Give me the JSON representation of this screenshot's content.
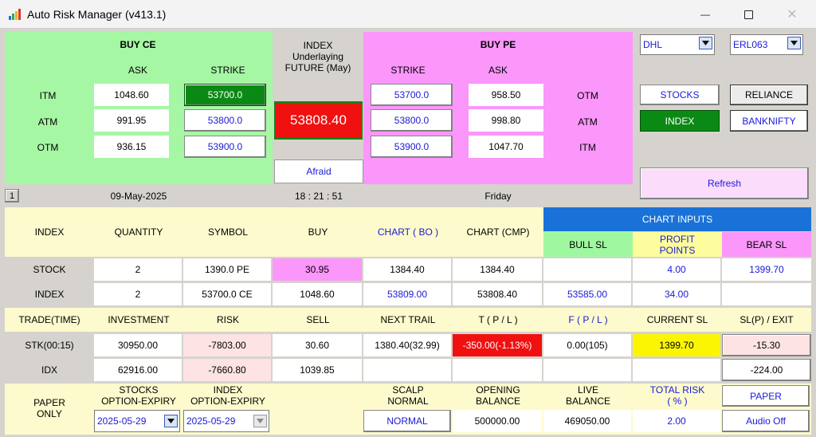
{
  "window": {
    "title": "Auto Risk Manager (v413.1)",
    "minimize_glyph": "—",
    "maximize_glyph": "☐",
    "close_glyph": "✕"
  },
  "buy_ce": {
    "title": "BUY CE",
    "col_ask": "ASK",
    "col_strike": "STRIKE",
    "rows": [
      {
        "label": "ITM",
        "ask": "1048.60",
        "strike": "53700.0"
      },
      {
        "label": "ATM",
        "ask": "991.95",
        "strike": "53800.0"
      },
      {
        "label": "OTM",
        "ask": "936.15",
        "strike": "53900.0"
      }
    ]
  },
  "index_center": {
    "line1": "INDEX",
    "line2": "Underlaying",
    "line3": "FUTURE (May)",
    "price": "53808.40",
    "mood_button": "Afraid"
  },
  "buy_pe": {
    "title": "BUY PE",
    "col_strike": "STRIKE",
    "col_ask": "ASK",
    "rows": [
      {
        "label": "OTM",
        "strike": "53700.0",
        "ask": "958.50"
      },
      {
        "label": "ATM",
        "strike": "53800.0",
        "ask": "998.80"
      },
      {
        "label": "ITM",
        "strike": "53900.0",
        "ask": "1047.70"
      }
    ]
  },
  "right_panel": {
    "dropdown1": "DHL",
    "dropdown2": "ERL063",
    "stocks_btn": "STOCKS",
    "reliance_btn": "RELIANCE",
    "index_btn": "INDEX",
    "banknifty_btn": "BANKNIFTY",
    "refresh_btn": "Refresh"
  },
  "status_bar": {
    "small_button": "1",
    "date": "09-May-2025",
    "time": "18 : 21 : 51",
    "day": "Friday"
  },
  "grid": {
    "headers": {
      "index": "INDEX",
      "quantity": "QUANTITY",
      "symbol": "SYMBOL",
      "buy": "BUY",
      "chart_bo": "CHART ( BO )",
      "chart_cmp": "CHART (CMP)",
      "chart_inputs": "CHART INPUTS",
      "bull_sl": "BULL SL",
      "profit_points": "PROFIT\nPOINTS",
      "bear_sl": "BEAR SL"
    },
    "rows": [
      {
        "label": "STOCK",
        "quantity": "2",
        "symbol": "1390.0  PE",
        "buy": "30.95",
        "chart_bo": "1384.40",
        "chart_cmp": "1384.40",
        "bull_sl": "",
        "profit_points": "4.00",
        "bear_sl": "1399.70"
      },
      {
        "label": "INDEX",
        "quantity": "2",
        "symbol": "53700.0  CE",
        "buy": "1048.60",
        "chart_bo": "53809.00",
        "chart_cmp": "53808.40",
        "bull_sl": "53585.00",
        "profit_points": "34.00",
        "bear_sl": ""
      }
    ],
    "headers2": {
      "trade_time": "TRADE(TIME)",
      "investment": "INVESTMENT",
      "risk": "RISK",
      "sell": "SELL",
      "next_trail": "NEXT TRAIL",
      "tpl": "T ( P / L )",
      "fpl": "F ( P / L )",
      "current_sl": "CURRENT SL",
      "slp_exit": "SL(P) / EXIT"
    },
    "rows2": [
      {
        "label": "STK(00:15)",
        "investment": "30950.00",
        "risk": "-7803.00",
        "sell": "30.60",
        "next_trail": "1380.40(32.99)",
        "tpl": "-350.00(-1.13%)",
        "fpl": "0.00(105)",
        "current_sl": "1399.70",
        "slp_exit": "-15.30"
      },
      {
        "label": "IDX",
        "investment": "62916.00",
        "risk": "-7660.80",
        "sell": "1039.85",
        "next_trail": "",
        "tpl": "",
        "fpl": "",
        "current_sl": "",
        "slp_exit": "-224.00"
      }
    ],
    "footer": {
      "paper_only": "PAPER\nONLY",
      "stocks_expiry_label": "STOCKS\nOPTION-EXPIRY",
      "index_expiry_label": "INDEX\nOPTION-EXPIRY",
      "scalp_label": "SCALP\nNORMAL",
      "opening_balance_label": "OPENING\nBALANCE",
      "live_balance_label": "LIVE\nBALANCE",
      "total_risk_label": "TOTAL RISK\n( % )",
      "paper_btn": "PAPER",
      "stocks_expiry": "2025-05-29",
      "index_expiry": "2025-05-29",
      "scalp_value": "NORMAL",
      "opening_balance": "500000.00",
      "live_balance": "469050.00",
      "total_risk": "2.00",
      "audio_btn": "Audio Off"
    }
  },
  "colors": {
    "green_panel": "#a6f7a4",
    "pink_panel": "#fb96fb",
    "yellow_bg": "#fdfbcd",
    "dark_green": "#0a8a14",
    "price_red": "#f01010",
    "chart_inputs_blue": "#1a72d8",
    "bull_sl_green": "#9ff79f",
    "profit_yellow": "#fdfd9d",
    "bear_pink": "#fb96fb",
    "risk_pink": "#fde3e3",
    "current_sl_yellow": "#fbf502"
  }
}
